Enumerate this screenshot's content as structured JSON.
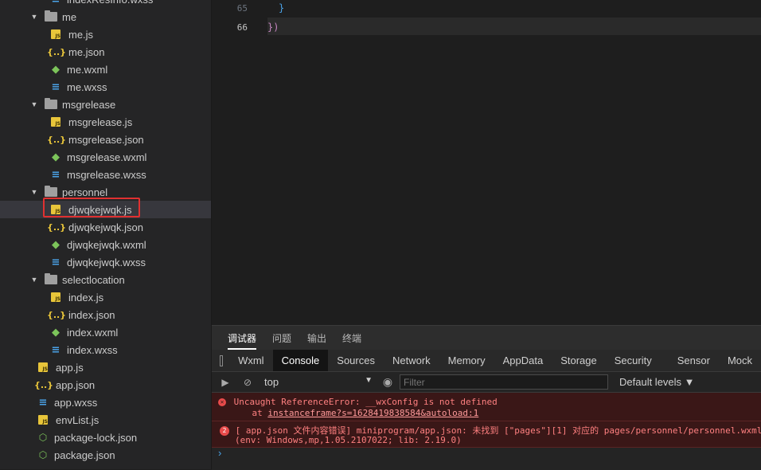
{
  "sidebar": {
    "items": [
      {
        "label": "indexResInfo.wxss",
        "type": "wxss",
        "indent": 2
      },
      {
        "label": "me",
        "type": "folder",
        "indent": 1
      },
      {
        "label": "me.js",
        "type": "js",
        "indent": 2
      },
      {
        "label": "me.json",
        "type": "json",
        "indent": 2
      },
      {
        "label": "me.wxml",
        "type": "wxml",
        "indent": 2
      },
      {
        "label": "me.wxss",
        "type": "wxss",
        "indent": 2
      },
      {
        "label": "msgrelease",
        "type": "folder",
        "indent": 1
      },
      {
        "label": "msgrelease.js",
        "type": "js",
        "indent": 2
      },
      {
        "label": "msgrelease.json",
        "type": "json",
        "indent": 2
      },
      {
        "label": "msgrelease.wxml",
        "type": "wxml",
        "indent": 2
      },
      {
        "label": "msgrelease.wxss",
        "type": "wxss",
        "indent": 2
      },
      {
        "label": "personnel",
        "type": "folder",
        "indent": 1
      },
      {
        "label": "djwqkejwqk.js",
        "type": "js",
        "indent": 2,
        "selected": true
      },
      {
        "label": "djwqkejwqk.json",
        "type": "json",
        "indent": 2
      },
      {
        "label": "djwqkejwqk.wxml",
        "type": "wxml",
        "indent": 2
      },
      {
        "label": "djwqkejwqk.wxss",
        "type": "wxss",
        "indent": 2
      },
      {
        "label": "selectlocation",
        "type": "folder",
        "indent": 1
      },
      {
        "label": "index.js",
        "type": "js",
        "indent": 2
      },
      {
        "label": "index.json",
        "type": "json",
        "indent": 2
      },
      {
        "label": "index.wxml",
        "type": "wxml",
        "indent": 2
      },
      {
        "label": "index.wxss",
        "type": "wxss",
        "indent": 2
      },
      {
        "label": "app.js",
        "type": "js",
        "indent": 0
      },
      {
        "label": "app.json",
        "type": "json",
        "indent": 0
      },
      {
        "label": "app.wxss",
        "type": "wxss",
        "indent": 0
      },
      {
        "label": "envList.js",
        "type": "js",
        "indent": 0
      },
      {
        "label": "package-lock.json",
        "type": "pkg",
        "indent": 0
      },
      {
        "label": "package.json",
        "type": "pkg",
        "indent": 0
      }
    ]
  },
  "editor": {
    "lines": [
      {
        "number": "65",
        "text": "}"
      },
      {
        "number": "66",
        "text": "})"
      }
    ]
  },
  "devtools": {
    "top_tabs": [
      "调试器",
      "问题",
      "输出",
      "终端"
    ],
    "panel_tabs": [
      "Wxml",
      "Console",
      "Sources",
      "Network",
      "Memory",
      "AppData",
      "Storage",
      "Security",
      "Sensor",
      "Mock"
    ],
    "active_panel": "Console",
    "context": "top",
    "filter_placeholder": "Filter",
    "levels": "Default levels ▼",
    "messages": [
      {
        "line1": "Uncaught ReferenceError: __wxConfig is not defined",
        "line2_prefix": "    at ",
        "line2_link": "instanceframe?s=1628419838584&autoload:1"
      },
      {
        "count": "2",
        "line1": "[ app.json 文件内容错误] miniprogram/app.json: 未找到 [\"pages\"][1] 对应的 pages/personnel/personnel.wxml",
        "line2": "(env: Windows,mp,1.05.2107022; lib: 2.19.0)"
      }
    ],
    "prompt": "›"
  },
  "colors": {
    "error_bg": "#3a1717",
    "error_text": "#ff8080",
    "highlight": "#e03030"
  }
}
